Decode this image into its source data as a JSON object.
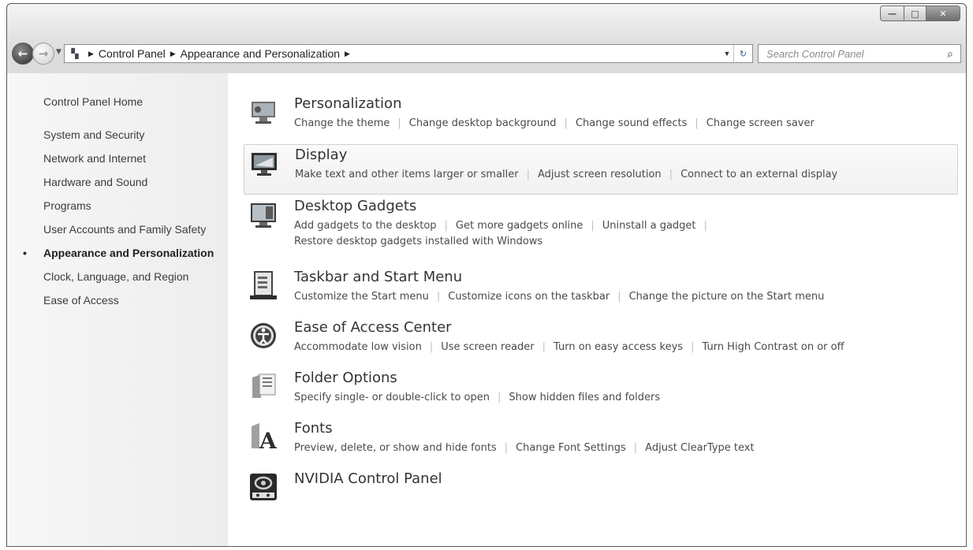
{
  "window": {
    "controls": {
      "minimize": "—",
      "maximize": "□",
      "close": "✕"
    }
  },
  "nav": {
    "back_icon": "back-arrow-icon",
    "forward_icon": "forward-arrow-icon",
    "breadcrumbs": [
      "Control Panel",
      "Appearance and Personalization"
    ],
    "search_placeholder": "Search Control Panel"
  },
  "sidebar": {
    "home": "Control Panel Home",
    "items": [
      {
        "label": "System and Security",
        "active": false
      },
      {
        "label": "Network and Internet",
        "active": false
      },
      {
        "label": "Hardware and Sound",
        "active": false
      },
      {
        "label": "Programs",
        "active": false
      },
      {
        "label": "User Accounts and Family Safety",
        "active": false
      },
      {
        "label": "Appearance and Personalization",
        "active": true
      },
      {
        "label": "Clock, Language, and Region",
        "active": false
      },
      {
        "label": "Ease of Access",
        "active": false
      }
    ]
  },
  "categories": [
    {
      "title": "Personalization",
      "icon": "personalization-icon",
      "links": [
        "Change the theme",
        "Change desktop background",
        "Change sound effects",
        "Change screen saver"
      ]
    },
    {
      "title": "Display",
      "icon": "display-icon",
      "highlighted": true,
      "links": [
        "Make text and other items larger or smaller",
        "Adjust screen resolution",
        "Connect to an external display"
      ]
    },
    {
      "title": "Desktop Gadgets",
      "icon": "gadgets-icon",
      "links": [
        "Add gadgets to the desktop",
        "Get more gadgets online",
        "Uninstall a gadget"
      ],
      "links2": [
        "Restore desktop gadgets installed with Windows"
      ]
    },
    {
      "title": "Taskbar and Start Menu",
      "icon": "taskbar-icon",
      "links": [
        "Customize the Start menu",
        "Customize icons on the taskbar",
        "Change the picture on the Start menu"
      ]
    },
    {
      "title": "Ease of Access Center",
      "icon": "ease-of-access-icon",
      "links": [
        "Accommodate low vision",
        "Use screen reader",
        "Turn on easy access keys",
        "Turn High Contrast on or off"
      ]
    },
    {
      "title": "Folder Options",
      "icon": "folder-options-icon",
      "links": [
        "Specify single- or double-click to open",
        "Show hidden files and folders"
      ]
    },
    {
      "title": "Fonts",
      "icon": "fonts-icon",
      "links": [
        "Preview, delete, or show and hide fonts",
        "Change Font Settings",
        "Adjust ClearType text"
      ]
    },
    {
      "title": "NVIDIA Control Panel",
      "icon": "nvidia-icon",
      "links": []
    }
  ]
}
